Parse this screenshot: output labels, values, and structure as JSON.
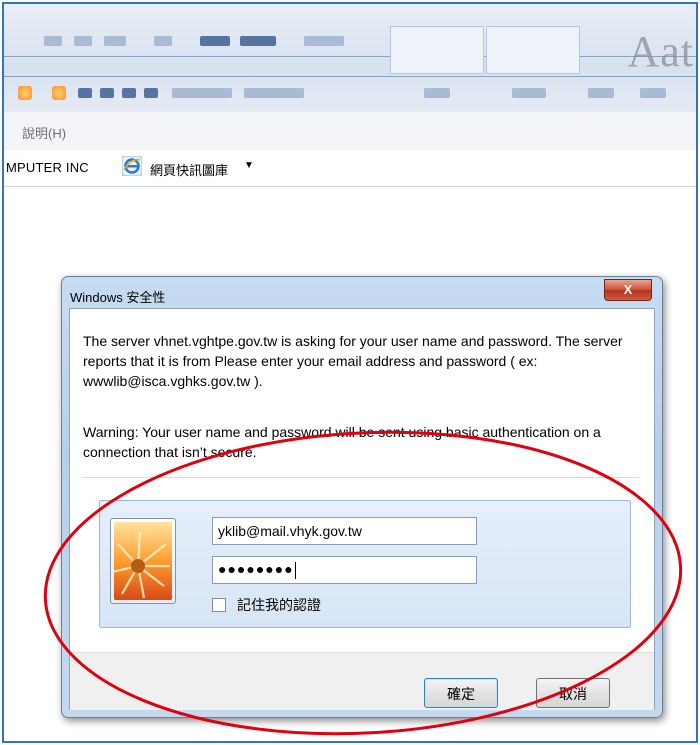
{
  "ribbon": {
    "aat_text": "Aat"
  },
  "menubar": {
    "help_label": "說明(H)"
  },
  "favorites": {
    "company_label": "MPUTER INC",
    "gallery_label": "網頁快訊圖庫",
    "dropdown_arrow": "▼"
  },
  "dialog": {
    "title": "Windows 安全性",
    "close_label": "X",
    "message": "The server vhnet.vghtpe.gov.tw is asking for your user name and password. The server reports that it is from Please enter your email address and password ( ex: wwwlib@isca.vghks.gov.tw ).",
    "warning": "Warning: Your user name and password will be sent using basic authentication on a connection that isn’t secure.",
    "username_value": "yklib@mail.vhyk.gov.tw",
    "password_value": "●●●●●●●●",
    "remember_label": "記住我的認證",
    "remember_checked": false,
    "ok_label": "確定",
    "cancel_label": "取消"
  },
  "colors": {
    "annotation": "#e0000f",
    "frame_border": "#2e75c6"
  }
}
